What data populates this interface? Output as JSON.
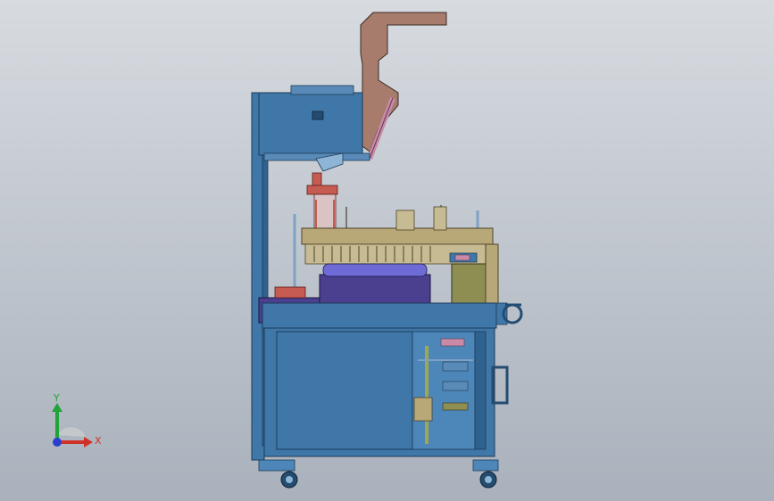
{
  "viewport": {
    "background_top": "#d7dbe0",
    "background_bottom": "#a9b1bc"
  },
  "colors": {
    "frame_blue": "#3f77a8",
    "frame_dark": "#244c70",
    "hopper_brown": "#a87c6c",
    "motor_purple": "#4b3f90",
    "tan": "#b8a878",
    "olive": "#8e8d52",
    "pink": "#c98aa8",
    "red": "#c65b52",
    "axis_x": "#d0322a",
    "axis_y": "#22a33a",
    "axis_z": "#2a3fd0"
  },
  "triad": {
    "x_label": "X",
    "y_label": "Y"
  }
}
